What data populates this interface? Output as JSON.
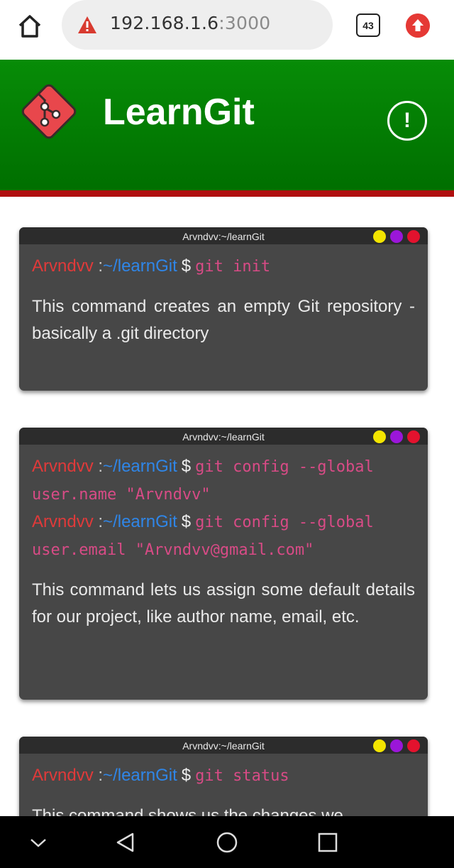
{
  "browser": {
    "url_host": "192.168.1.6",
    "url_port": ":3000",
    "tab_count": "43",
    "icons": [
      "home-icon",
      "warning-icon",
      "tabs-icon",
      "update-icon"
    ]
  },
  "header": {
    "title": "LearnGit",
    "info_label": "!",
    "colors": {
      "background": "#078c07",
      "stripe": "#b00f0f"
    }
  },
  "terminals": [
    {
      "window_title": "Arvndvv:~/learnGit",
      "lines": [
        {
          "user": "Arvndvv",
          "sep": ":",
          "path": "~/learnGit",
          "dollar": "$",
          "command": "git init"
        }
      ],
      "description": "This command creates an empty Git repository - basically a .git directory"
    },
    {
      "window_title": "Arvndvv:~/learnGit",
      "lines": [
        {
          "user": "Arvndvv",
          "sep": ":",
          "path": "~/learnGit",
          "dollar": "$",
          "command": "git config --global user.name \"Arvndvv\""
        },
        {
          "user": "Arvndvv",
          "sep": ":",
          "path": "~/learnGit",
          "dollar": "$",
          "command": "git config --global user.email \"Arvndvv@gmail.com\""
        }
      ],
      "description": "This command lets us assign some default details for our project, like author name, email, etc."
    },
    {
      "window_title": "Arvndvv:~/learnGit",
      "lines": [
        {
          "user": "Arvndvv",
          "sep": ":",
          "path": "~/learnGit",
          "dollar": "$",
          "command": "git status"
        }
      ],
      "description": "This command shows us the changes we"
    }
  ],
  "navigation": {
    "icons": [
      "chevron-down-icon",
      "back-icon",
      "home-circle-icon",
      "recents-icon"
    ]
  }
}
